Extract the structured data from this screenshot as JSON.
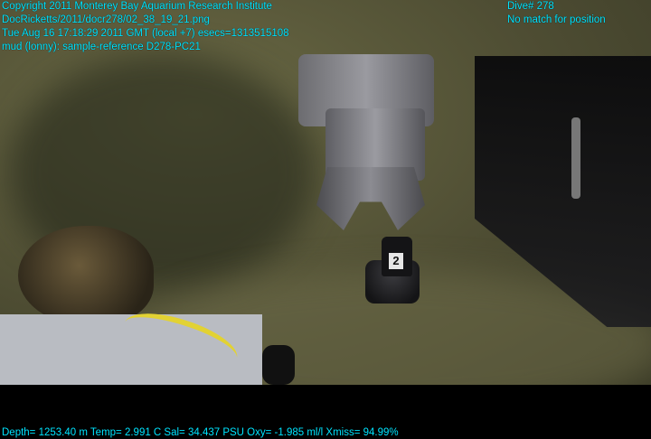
{
  "overlay": {
    "header_left": [
      "Copyright 2011 Monterey Bay Aquarium Research Institute",
      "DocRicketts/2011/docr278/02_38_19_21.png",
      "Tue Aug 16 17:18:29 2011 GMT (local +7)  esecs=1313515108",
      "mud (lonny): sample-reference D278-PC21"
    ],
    "header_right": [
      "Dive# 278",
      "No match for position"
    ],
    "footer": "Depth= 1253.40 m  Temp= 2.991 C  Sal= 34.437 PSU  Oxy= -1.985 ml/l  Xmiss= 94.99%"
  },
  "scene": {
    "tube_label": "2"
  },
  "colors": {
    "overlay_text": "#00e4ff",
    "seafloor": "#55543a",
    "tray": "#b9bcc2",
    "strap": "#e2d233"
  }
}
